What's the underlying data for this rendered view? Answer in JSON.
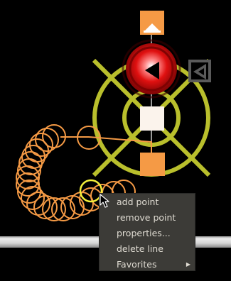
{
  "context_menu": {
    "items": [
      {
        "label": "add point"
      },
      {
        "label": "remove point"
      },
      {
        "label": "properties..."
      },
      {
        "label": "delete line"
      },
      {
        "label": "Favorites"
      }
    ]
  },
  "colors": {
    "background": "#000000",
    "orange": "#f59a45",
    "olive": "#b9bf2c",
    "red": "#e01010",
    "menu_bg": "#3c3b37",
    "menu_text": "#dfdbd2"
  },
  "icons": {
    "submenu": "triangle-right-icon",
    "cursor": "arrow-pointer-icon"
  }
}
